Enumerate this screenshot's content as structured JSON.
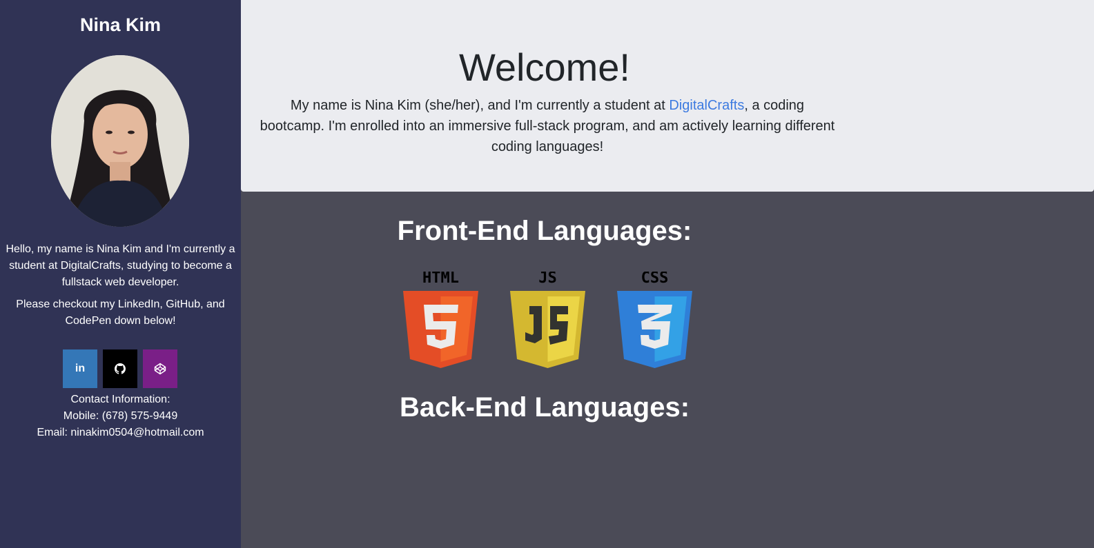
{
  "sidebar": {
    "name": "Nina Kim",
    "bio_1": "Hello, my name is Nina Kim and I'm currently a student at DigitalCrafts, studying to become a fullstack web developer.",
    "bio_2": "Please checkout my LinkedIn, GitHub, and CodePen down below!",
    "social": [
      {
        "label": "in",
        "icon": "linkedin-icon",
        "color": "#3477b7"
      },
      {
        "label": "",
        "icon": "github-icon",
        "color": "#000000"
      },
      {
        "label": "",
        "icon": "codepen-icon",
        "color": "#7a1f87"
      }
    ],
    "contact": {
      "heading": "Contact Information:",
      "mobile": "Mobile: (678) 575-9449",
      "email": "Email: ninakim0504@hotmail.com"
    }
  },
  "hero": {
    "title": "Welcome!",
    "intro_before": "My name is Nina Kim (she/her), and I'm currently a student at ",
    "intro_link": "DigitalCrafts",
    "intro_after": ", a coding bootcamp. I'm enrolled into an immersive full-stack program, and am actively learning different coding languages!"
  },
  "frontend": {
    "heading": "Front-End Languages:",
    "logos": [
      {
        "label": "HTML",
        "icon": "html5-logo",
        "color": "#e44d26"
      },
      {
        "label": "JS",
        "icon": "javascript-logo",
        "color": "#d4b830"
      },
      {
        "label": "CSS",
        "icon": "css3-logo",
        "color": "#2f7fd8"
      }
    ]
  },
  "backend": {
    "heading": "Back-End Languages:"
  },
  "colors": {
    "sidebar_bg": "#303355",
    "hero_bg": "#ebecf0",
    "main_bg": "#4b4b57",
    "link": "#3c7ae0"
  }
}
